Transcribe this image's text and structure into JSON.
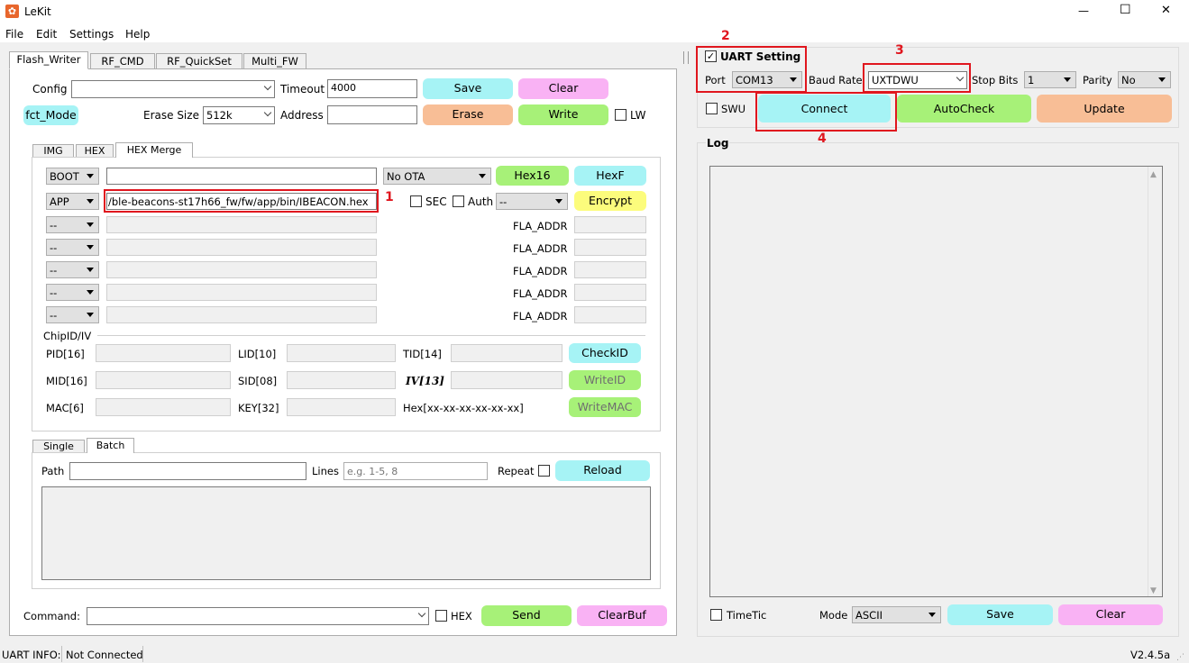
{
  "window": {
    "title": "LeKit",
    "minimize": "—",
    "maximize": "☐",
    "close": "✕"
  },
  "menu": [
    "File",
    "Edit",
    "Settings",
    "Help"
  ],
  "tabs": [
    "Flash_Writer",
    "RF_CMD",
    "RF_QuickSet",
    "Multi_FW"
  ],
  "config": {
    "config_label": "Config",
    "config_value": "",
    "timeout_label": "Timeout",
    "timeout_value": "4000",
    "save": "Save",
    "clear": "Clear",
    "fct_mode": "fct_Mode",
    "erase_size_label": "Erase Size",
    "erase_size_value": "512k",
    "address_label": "Address",
    "address_value": "",
    "erase": "Erase",
    "write": "Write",
    "lw": "LW"
  },
  "subtabs": [
    "IMG",
    "HEX",
    "HEX Merge"
  ],
  "hexmerge": {
    "boot_sel": "BOOT",
    "boot_path": "",
    "ota": "No OTA",
    "hex16": "Hex16",
    "hexf": "HexF",
    "app_sel": "APP",
    "app_path": "/ble-beacons-st17h66_fw/fw/app/bin/IBEACON.hex",
    "sec": "SEC",
    "auth": "Auth",
    "auth_sel": "--",
    "encrypt": "Encrypt",
    "rows": [
      {
        "sel": "--",
        "fla": "FLA_ADDR"
      },
      {
        "sel": "--",
        "fla": "FLA_ADDR"
      },
      {
        "sel": "--",
        "fla": "FLA_ADDR"
      },
      {
        "sel": "--",
        "fla": "FLA_ADDR"
      },
      {
        "sel": "--",
        "fla": "FLA_ADDR"
      }
    ]
  },
  "chipid": {
    "title": "ChipID/IV",
    "pid": "PID[16]",
    "lid": "LID[10]",
    "tid": "TID[14]",
    "checkid": "CheckID",
    "mid": "MID[16]",
    "sid": "SID[08]",
    "iv": "IV[13]",
    "writeid": "WriteID",
    "mac": "MAC[6]",
    "key": "KEY[32]",
    "hexfmt": "Hex[xx-xx-xx-xx-xx-xx]",
    "writemac": "WriteMAC"
  },
  "batch_tabs": [
    "Single",
    "Batch"
  ],
  "batch": {
    "path": "Path",
    "lines": "Lines",
    "lines_placeholder": "e.g. 1-5, 8",
    "repeat": "Repeat",
    "reload": "Reload"
  },
  "command": {
    "label": "Command:",
    "value": "",
    "hex": "HEX",
    "send": "Send",
    "clearbuf": "ClearBuf"
  },
  "uart": {
    "title": "UART Setting",
    "port_label": "Port",
    "port": "COM13",
    "baud_label": "Baud Rate",
    "baud": "UXTDWU",
    "stop_label": "Stop Bits",
    "stop": "1",
    "parity_label": "Parity",
    "parity": "No",
    "swu": "SWU",
    "connect": "Connect",
    "autocheck": "AutoCheck",
    "update": "Update"
  },
  "log": {
    "title": "Log",
    "timetic": "TimeTic",
    "mode_label": "Mode",
    "mode": "ASCII",
    "save": "Save",
    "clear": "Clear"
  },
  "status": {
    "uart_info": "UART INFO:",
    "state": "Not Connected",
    "version": "V2.4.5a"
  },
  "annotations": [
    "1",
    "2",
    "3",
    "4"
  ],
  "colors": {
    "cyan": "#a6f3f5",
    "pink": "#f9b2f4",
    "orange": "#f8be96",
    "green": "#a7f178",
    "yellow": "#fcfc7c",
    "annotation_red": "#e0161e"
  }
}
